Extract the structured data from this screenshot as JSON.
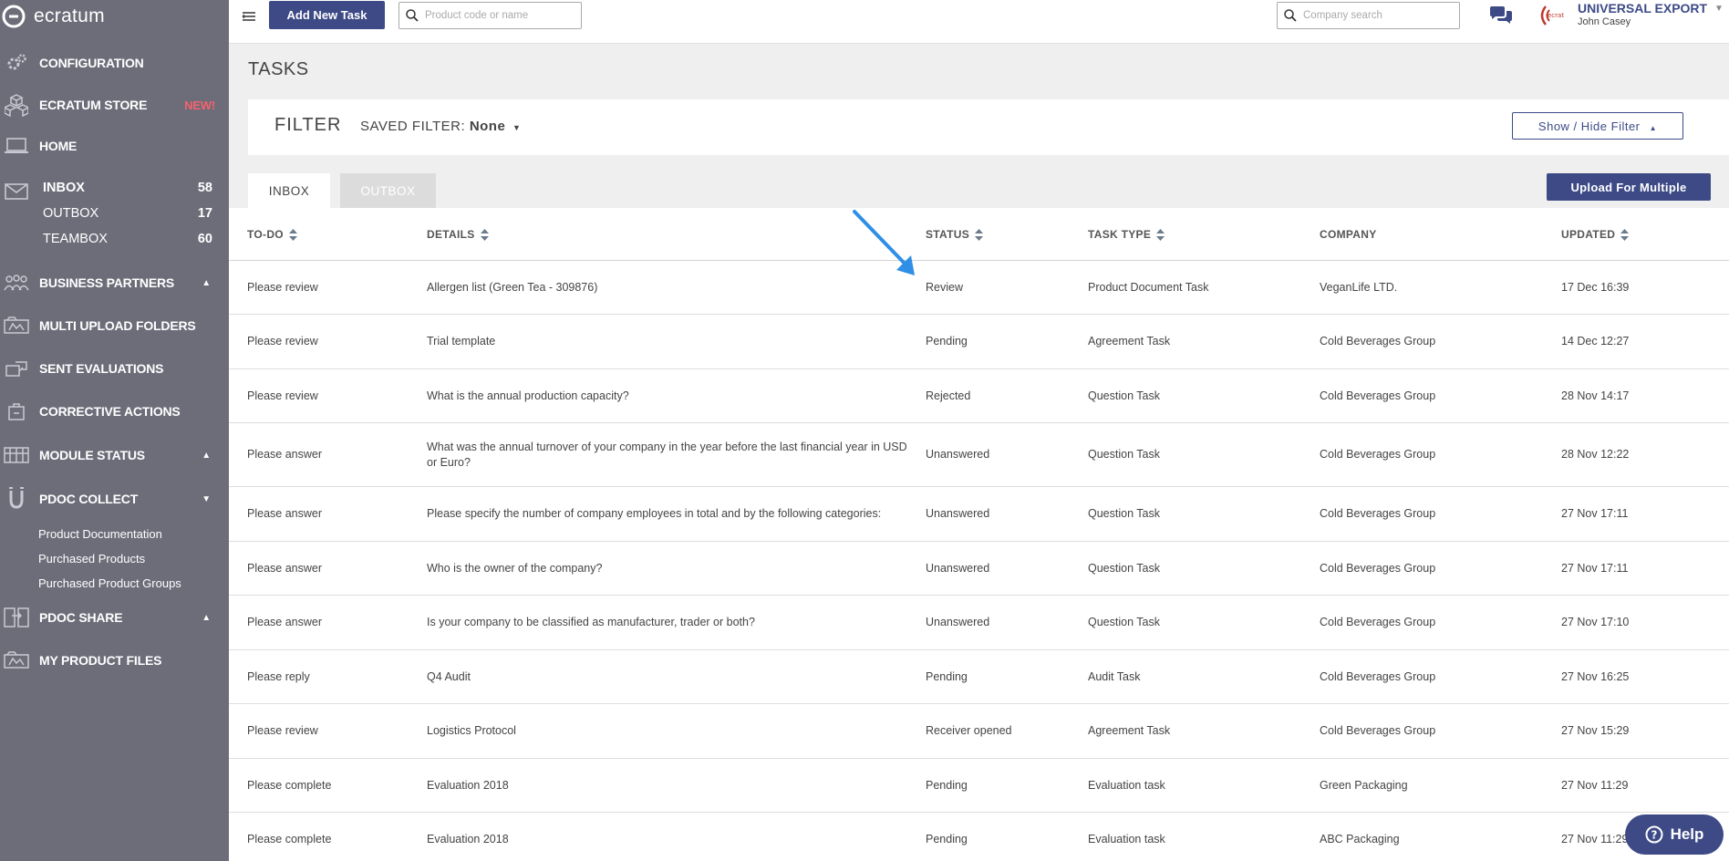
{
  "app": {
    "name": "ecratum"
  },
  "sidebar": {
    "configuration": "CONFIGURATION",
    "store": {
      "label": "ECRATUM STORE",
      "badge": "NEW!"
    },
    "home": "HOME",
    "mail": [
      {
        "label": "INBOX",
        "count": "58"
      },
      {
        "label": "OUTBOX",
        "count": "17"
      },
      {
        "label": "TEAMBOX",
        "count": "60"
      }
    ],
    "business_partners": "BUSINESS PARTNERS",
    "multi_upload": "MULTI UPLOAD FOLDERS",
    "sent_evaluations": "SENT EVALUATIONS",
    "corrective_actions": "CORRECTIVE ACTIONS",
    "module_status": "MODULE STATUS",
    "pdoc_collect": {
      "label": "PDOC COLLECT",
      "sub": [
        "Product Documentation",
        "Purchased Products",
        "Purchased Product Groups"
      ]
    },
    "pdoc_share": "PDOC SHARE",
    "my_product_files": "MY PRODUCT FILES"
  },
  "topbar": {
    "add_task": "Add New Task",
    "product_search_placeholder": "Product code or name",
    "company_search_placeholder": "Company search",
    "company": "UNIVERSAL EXPORT",
    "user": "John Casey"
  },
  "page": {
    "title": "TASKS",
    "filter_title": "FILTER",
    "saved_filter_label": "SAVED FILTER:",
    "saved_filter_value": "None",
    "toggle_filter": "Show / Hide Filter",
    "tabs": [
      "INBOX",
      "OUTBOX"
    ],
    "upload": "Upload For Multiple"
  },
  "table": {
    "headers": [
      "TO-DO",
      "DETAILS",
      "STATUS",
      "TASK TYPE",
      "COMPANY",
      "UPDATED"
    ],
    "rows": [
      [
        "Please review",
        "Allergen list (Green Tea - 309876)",
        "Review",
        "Product Document Task",
        "VeganLife LTD.",
        "17 Dec 16:39"
      ],
      [
        "Please review",
        "Trial template",
        "Pending",
        "Agreement Task",
        "Cold Beverages Group",
        "14 Dec 12:27"
      ],
      [
        "Please review",
        "What is the annual production capacity?",
        "Rejected",
        "Question Task",
        "Cold Beverages Group",
        "28 Nov 14:17"
      ],
      [
        "Please answer",
        "What was the annual turnover of your company in the year before the last financial year in USD or Euro?",
        "Unanswered",
        "Question Task",
        "Cold Beverages Group",
        "28 Nov 12:22"
      ],
      [
        "Please answer",
        "Please specify the number of company employees in total and by the following categories:",
        "Unanswered",
        "Question Task",
        "Cold Beverages Group",
        "27 Nov 17:11"
      ],
      [
        "Please answer",
        "Who is the owner of the company?",
        "Unanswered",
        "Question Task",
        "Cold Beverages Group",
        "27 Nov 17:11"
      ],
      [
        "Please answer",
        "Is your company to be classified as manufacturer, trader or both?",
        "Unanswered",
        "Question Task",
        "Cold Beverages Group",
        "27 Nov 17:10"
      ],
      [
        "Please reply",
        "Q4 Audit",
        "Pending",
        "Audit Task",
        "Cold Beverages Group",
        "27 Nov 16:25"
      ],
      [
        "Please review",
        "Logistics Protocol",
        "Receiver opened",
        "Agreement Task",
        "Cold Beverages Group",
        "27 Nov 15:29"
      ],
      [
        "Please complete",
        "Evaluation 2018",
        "Pending",
        "Evaluation task",
        "Green Packaging",
        "27 Nov 11:29"
      ],
      [
        "Please complete",
        "Evaluation 2018",
        "Pending",
        "Evaluation task",
        "ABC Packaging",
        "27 Nov 11:29"
      ]
    ]
  },
  "help": "Help",
  "colors": {
    "sidebar": "#6c6d79",
    "primary": "#3d4a86",
    "badge": "#f6626d",
    "arrow": "#2f8fe6"
  }
}
